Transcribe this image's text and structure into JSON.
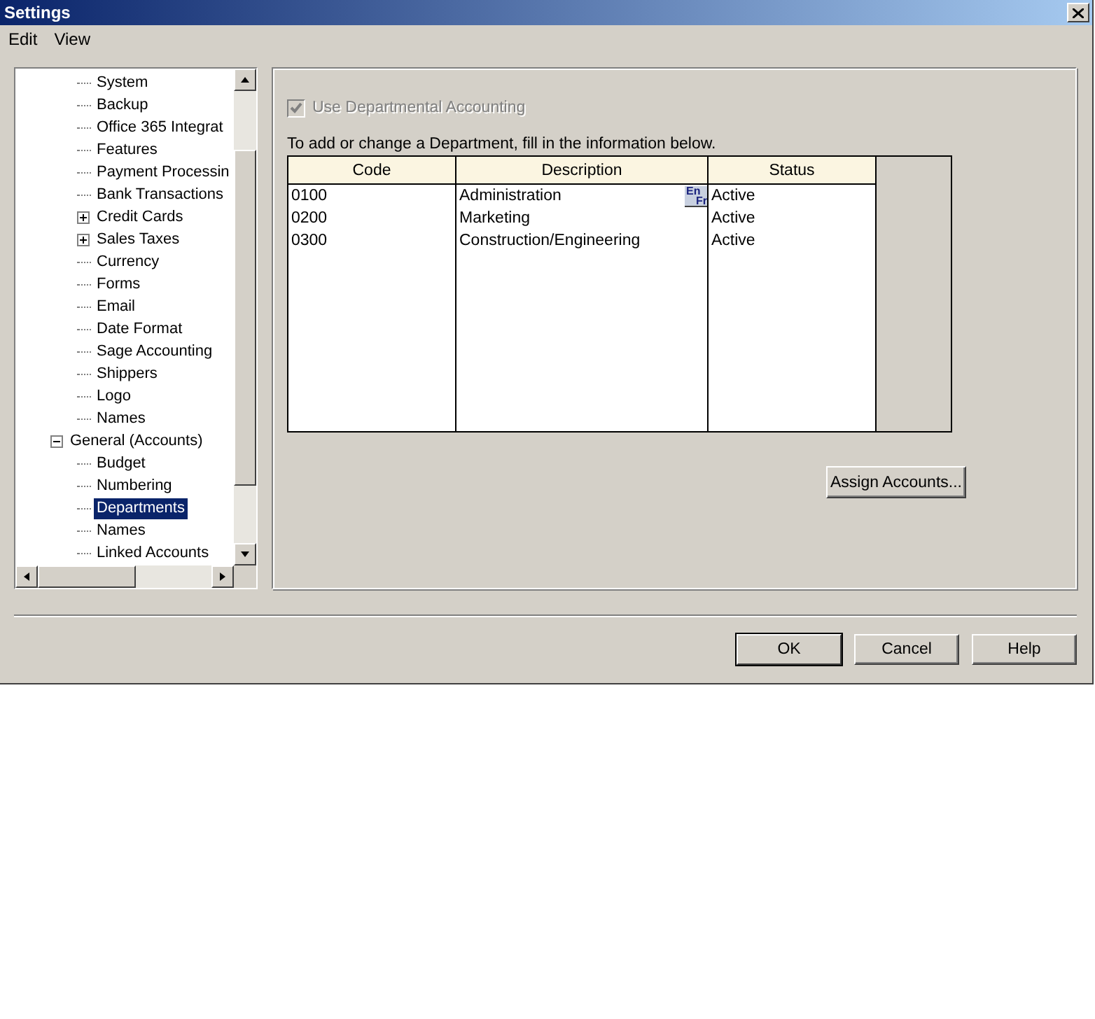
{
  "window": {
    "title": "Settings"
  },
  "menu": [
    "Edit",
    "View"
  ],
  "tree": {
    "continued_items": [
      {
        "label": "System",
        "selected": false
      },
      {
        "label": "Backup",
        "selected": false
      },
      {
        "label": "Office 365 Integrat",
        "selected": false
      },
      {
        "label": "Features",
        "selected": false
      },
      {
        "label": "Payment Processin",
        "selected": false
      },
      {
        "label": "Bank Transactions",
        "selected": false
      },
      {
        "label": "Credit Cards",
        "selected": false,
        "expanded": false
      },
      {
        "label": "Sales Taxes",
        "selected": false,
        "expanded": false
      },
      {
        "label": "Currency",
        "selected": false
      },
      {
        "label": "Forms",
        "selected": false
      },
      {
        "label": "Email",
        "selected": false
      },
      {
        "label": "Date Format",
        "selected": false
      },
      {
        "label": "Sage Accounting",
        "selected": false
      },
      {
        "label": "Shippers",
        "selected": false
      },
      {
        "label": "Logo",
        "selected": false
      },
      {
        "label": "Names",
        "selected": false
      }
    ],
    "items": [
      {
        "label": "General (Accounts)",
        "selected": false,
        "expanded": true,
        "children": [
          {
            "label": "Budget",
            "selected": false
          },
          {
            "label": "Numbering",
            "selected": false
          },
          {
            "label": "Departments",
            "selected": true
          },
          {
            "label": "Names",
            "selected": false
          },
          {
            "label": "Linked Accounts",
            "selected": false
          }
        ]
      }
    ]
  },
  "departmental": {
    "label": "Use Departmental Accounting",
    "checked": true,
    "disabled": true
  },
  "instruction": "To add or change a Department, fill in the information below.",
  "table": {
    "columns": [
      "Code",
      "Description",
      "Status"
    ],
    "rows": [
      {
        "code": "0100",
        "description": "Administration",
        "status": "Active",
        "language_toggle": [
          "En",
          "Fr"
        ]
      },
      {
        "code": "0200",
        "description": "Marketing",
        "status": "Active"
      },
      {
        "code": "0300",
        "description": "Construction/Engineering",
        "status": "Active"
      }
    ]
  },
  "assign_button": "Assign Accounts...",
  "buttons": [
    {
      "label": "OK",
      "default": true
    },
    {
      "label": "Cancel",
      "default": false
    },
    {
      "label": "Help",
      "default": false
    }
  ]
}
